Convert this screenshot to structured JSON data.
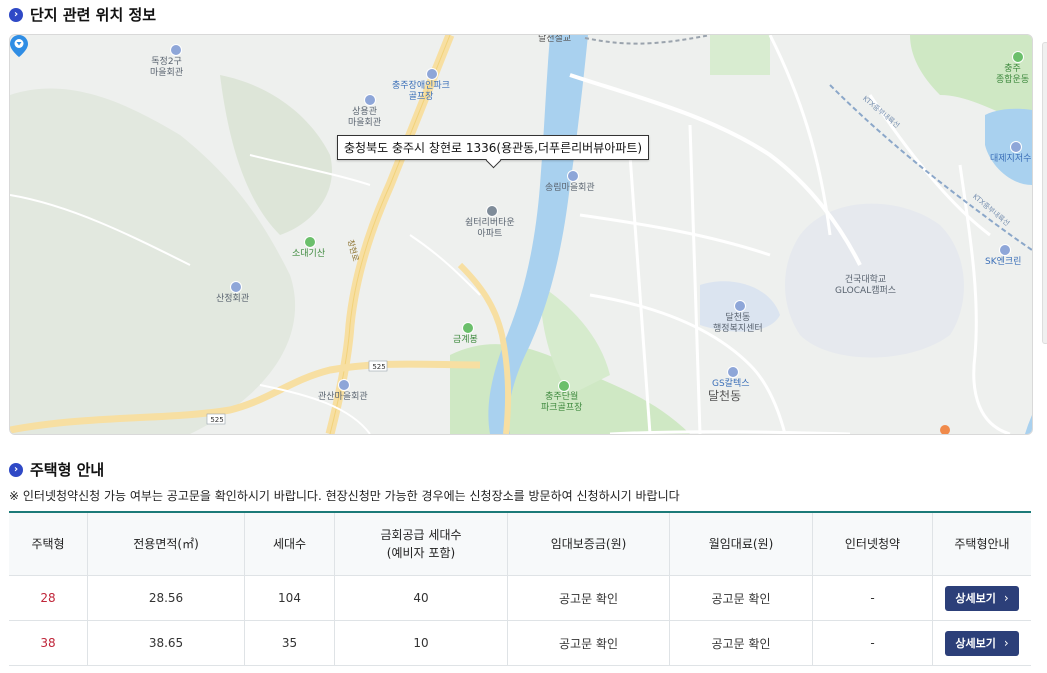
{
  "location": {
    "title": "단지 관련 위치 정보",
    "address_callout": "충청북도 충주시 창현로 1336(용관동,더푸른리버뷰아파트)",
    "map_labels": {
      "dokjeong": "독정2구\n마을회관",
      "chungju_disabled": "충주장애인파크\n골프장",
      "sangyong": "상용관\n마을회관",
      "songrim": "송림마을회관",
      "shelter": "쉼터리버타운\n아파트",
      "sodaegisan": "소대기산",
      "sanjeong": "산정회관",
      "geumgyebong": "금계봉",
      "gwansan": "관산마을회관",
      "chungju_park": "충주단월\n파크골프장",
      "dalcheon_center": "달천동\n행정복지센터",
      "gs_caltex": "GS칼텍스",
      "dalcheon_dong": "달천동",
      "konkuk": "건국대학교\nGLOCAL캠퍼스",
      "sk_encline": "SK엔크린",
      "daeje": "대제지저수",
      "chungju_stadium": "충주\n종합운동",
      "road_525a": "525",
      "road_525b": "525",
      "changhyeon_ro": "창현로",
      "dalcheon_bridge": "달천철교",
      "ktx_a": "KTX중부내륙선",
      "ktx_b": "KTX중부내륙선"
    }
  },
  "housing": {
    "title": "주택형 안내",
    "notice": "※ 인터넷청약신청 가능 여부는 공고문을 확인하시기 바랍니다. 현장신청만 가능한 경우에는 신청장소를 방문하여 신청하시기 바랍니다",
    "headers": [
      "주택형",
      "전용면적(㎡)",
      "세대수",
      "금회공급 세대수\n(예비자 포함)",
      "임대보증금(원)",
      "월임대료(원)",
      "인터넷청약",
      "주택형안내"
    ],
    "rows": [
      {
        "type": "28",
        "area": "28.56",
        "households": "104",
        "supply": "40",
        "deposit": "공고문 확인",
        "rent": "공고문 확인",
        "internet": "-",
        "button": "상세보기"
      },
      {
        "type": "38",
        "area": "38.65",
        "households": "35",
        "supply": "10",
        "deposit": "공고문 확인",
        "rent": "공고문 확인",
        "internet": "-",
        "button": "상세보기"
      }
    ],
    "accent_color": "#1c7a78",
    "type_color": "#c0263a",
    "button_color": "#2c3f79"
  }
}
